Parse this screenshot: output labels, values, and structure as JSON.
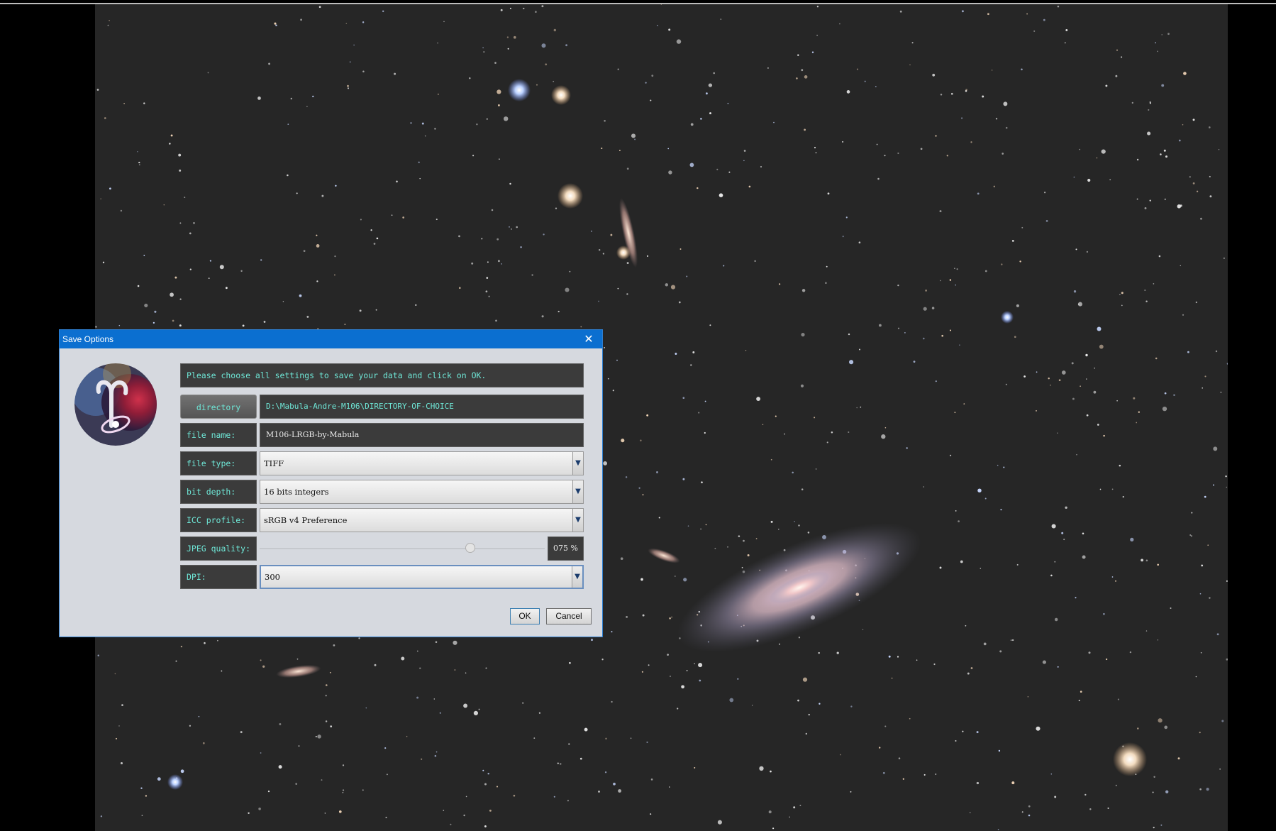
{
  "dialog": {
    "title": "Save Options",
    "message": "Please choose all settings to save your data and click on OK.",
    "directory_label": "directory",
    "directory_value": "D:\\Mabula-Andre-M106\\DIRECTORY-OF-CHOICE",
    "file_name_label": "file name:",
    "file_name_value": "M106-LRGB-by-Mabula",
    "file_type_label": "file type:",
    "file_type_value": "TIFF",
    "bit_depth_label": "bit depth:",
    "bit_depth_value": "16 bits integers",
    "icc_label": "ICC profile:",
    "icc_value": "sRGB v4 Preference",
    "jpeg_label": "JPEG quality:",
    "jpeg_value": "075 %",
    "jpeg_level": 0.75,
    "dpi_label": "DPI:",
    "dpi_value": "300",
    "ok_label": "OK",
    "cancel_label": "Cancel",
    "dropdown_arrow": "▼",
    "close_glyph": "✕"
  },
  "colors": {
    "titlebar": "#0b6fd0",
    "label_text": "#6fe8d8",
    "panel": "#d6d9df",
    "sky": "#262626"
  }
}
